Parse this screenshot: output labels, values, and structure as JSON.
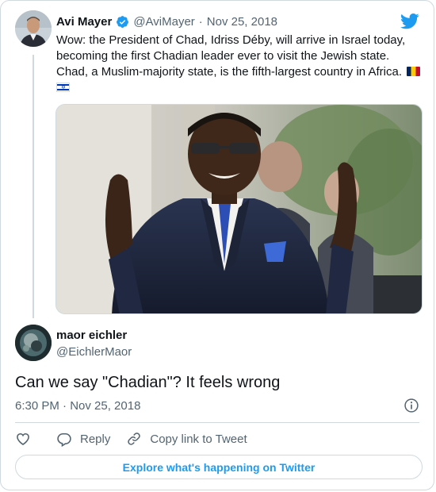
{
  "tweet": {
    "author_name": "Avi Mayer",
    "author_handle": "@AviMayer",
    "separator": "·",
    "date": "Nov 25, 2018",
    "text": "Wow: the President of Chad, Idriss Déby, will arrive in Israel today, becoming the first Chadian leader ever to visit the Jewish state. Chad, a Muslim-majority state, is the fifth-largest country in Africa.",
    "flags": [
      "chad-flag-icon",
      "israel-flag-icon"
    ],
    "media_subject": "photo"
  },
  "reply": {
    "author_name": "maor eichler",
    "author_handle": "@EichlerMaor",
    "text": "Can we say \"Chadian\"? It feels wrong",
    "timestamp": "6:30 PM · Nov 25, 2018"
  },
  "actions": {
    "like_icon": "heart-icon",
    "reply_label": "Reply",
    "copy_label": "Copy link to Tweet"
  },
  "footer": {
    "explore_label": "Explore what's happening on Twitter"
  },
  "colors": {
    "accent": "#1d9bf0",
    "text": "#0f1419",
    "muted": "#536471",
    "border": "#cfd9de"
  }
}
